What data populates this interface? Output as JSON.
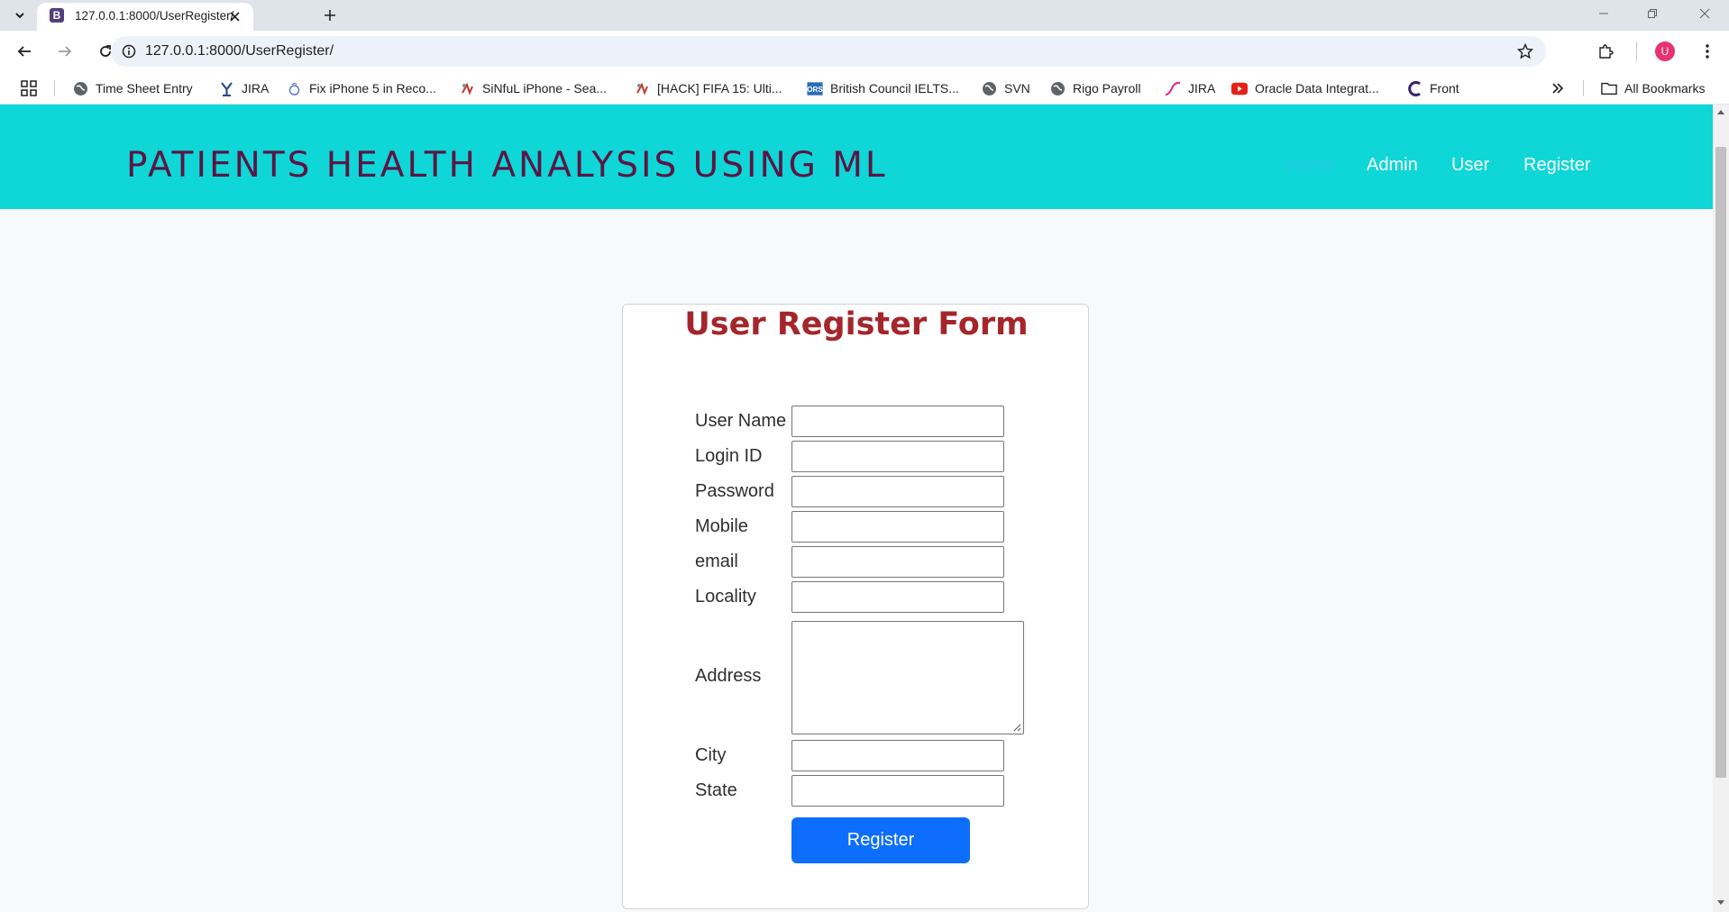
{
  "browser": {
    "tab_title": "127.0.0.1:8000/UserRegister/",
    "tab_favicon_letter": "B",
    "url": "127.0.0.1:8000/UserRegister/",
    "profile_initial": "U",
    "bookmarks": [
      {
        "label": "Time Sheet Entry",
        "icon": "globe-icon"
      },
      {
        "label": "JIRA",
        "icon": "jira-icon"
      },
      {
        "label": "Fix iPhone 5 in Reco...",
        "icon": "site-icon"
      },
      {
        "label": "SiNfuL iPhone - Sea...",
        "icon": "site-icon"
      },
      {
        "label": "[HACK] FIFA 15: Ulti...",
        "icon": "site-icon"
      },
      {
        "label": "British Council IELTS...",
        "icon": "ors-icon"
      },
      {
        "label": "SVN",
        "icon": "globe-icon"
      },
      {
        "label": "Rigo Payroll",
        "icon": "globe-icon"
      },
      {
        "label": "JIRA",
        "icon": "jira-curve-icon"
      },
      {
        "label": "Oracle Data Integrat...",
        "icon": "youtube-icon"
      },
      {
        "label": "Front",
        "icon": "front-icon"
      }
    ],
    "all_bookmarks_label": "All Bookmarks"
  },
  "site": {
    "brand": "PATIENTS HEALTH ANALYSIS USING ML",
    "nav": [
      "Home",
      "Admin",
      "User",
      "Register"
    ]
  },
  "form": {
    "title": "User Register Form",
    "labels": {
      "username": "User Name",
      "loginid": "Login ID",
      "password": "Password",
      "mobile": "Mobile",
      "email": "email",
      "locality": "Locality",
      "address": "Address",
      "city": "City",
      "state": "State"
    },
    "values": {
      "username": "",
      "loginid": "",
      "password": "",
      "mobile": "",
      "email": "",
      "locality": "",
      "address": "",
      "city": "",
      "state": ""
    },
    "submit_label": "Register"
  },
  "colors": {
    "header_bg": "#0fd7d7",
    "brand_text": "#5a1645",
    "form_title": "#a4262c",
    "button_bg": "#0d6efd"
  }
}
